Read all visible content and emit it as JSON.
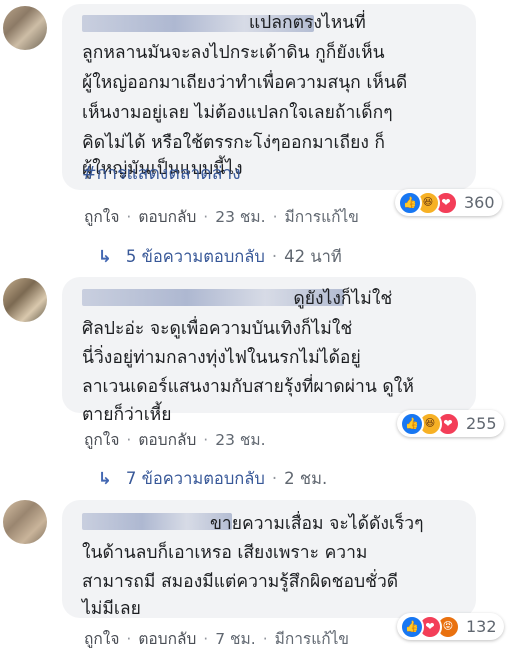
{
  "comments": [
    {
      "lines": [
        "                              แปลกตรงไหนที่",
        "ลูกหลานมันจะลงไปกระเด้าดิน กูก็ยังเห็น",
        "ผู้ใหญ่ออกมาเถียงว่าทำเพื่อความสนุก เห็นดี",
        "เห็นงามอยู่เลย ไม่ต้องแปลกใจเลยถ้าเด็กๆ",
        "คิดไม่ได้ หรือใช้ตรรกะโง่ๆออกมาเถียง ก็",
        "ผู้ใหญ่มันเป็นแบบนี้ไง"
      ],
      "hashtag": "#การแสดงตลาดล่าง",
      "reaction_count": "360",
      "actions": {
        "like": "ถูกใจ",
        "reply": "ตอบกลับ",
        "time": "23 ชม.",
        "edited": "มีการแก้ไข"
      },
      "replies": {
        "label": "5 ข้อความตอบกลับ",
        "time": "42 นาที"
      }
    },
    {
      "lines": [
        "                                      ดูยังไงก็ไม่ใช่",
        "ศิลปะอ่ะ จะดูเพื่อความบันเทิงก็ไม่ใช่",
        "นี่วิ่งอยู่ท่ามกลางทุ่งไฟในนรกไม่ได้อยู่",
        "ลาเวนเดอร์แสนงามกับสายรุ้งที่ผาดผ่าน ดูให้",
        "ตายก็ว่าเหี้ย"
      ],
      "reaction_count": "255",
      "actions": {
        "like": "ถูกใจ",
        "reply": "ตอบกลับ",
        "time": "23 ชม."
      },
      "replies": {
        "label": "7 ข้อความตอบกลับ",
        "time": "2 ชม."
      }
    },
    {
      "lines": [
        "                       ขายความเสื่อม จะได้ดังเร็วๆ",
        "ในด้านลบก็เอาเหรอ เสียงเพราะ ความ",
        "สามารถมี สมองมีแต่ความรู้สึกผิดชอบชั่วดี",
        "ไม่มีเลย"
      ],
      "reaction_count": "132",
      "actions": {
        "like": "ถูกใจ",
        "reply": "ตอบกลับ",
        "time": "7 ชม.",
        "edited": "มีการแก้ไข"
      }
    }
  ],
  "icons": {
    "like": "thumbs-up-icon",
    "haha": "laughing-face-icon",
    "love": "heart-icon",
    "angry": "angry-face-icon",
    "reply_arrow": "reply-arrow-icon"
  },
  "colors": {
    "link": "#385898",
    "bubble": "#f2f3f5",
    "like_blue": "#1877f2",
    "love_red": "#f33e58",
    "haha_yellow": "#f7b125"
  }
}
